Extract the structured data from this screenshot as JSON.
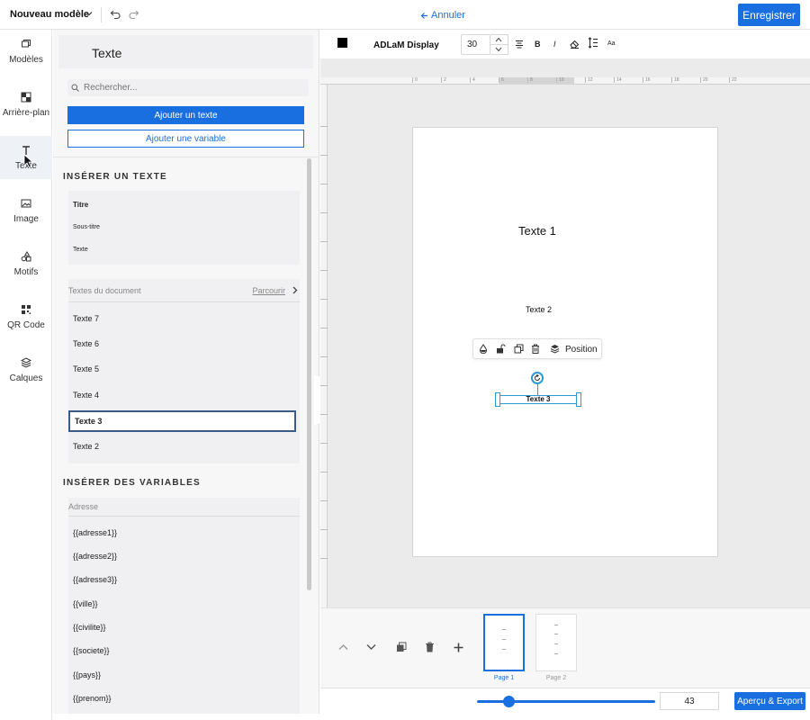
{
  "topbar": {
    "template_name": "Nouveau modèle",
    "cancel_label": "Annuler",
    "save_label": "Enregistrer"
  },
  "rail": {
    "items": [
      {
        "label": "Modèles",
        "icon": "templates-icon"
      },
      {
        "label": "Arrière-plan",
        "icon": "background-icon"
      },
      {
        "label": "Texte",
        "icon": "text-icon",
        "active": true
      },
      {
        "label": "Image",
        "icon": "image-icon"
      },
      {
        "label": "Motifs",
        "icon": "shapes-icon"
      },
      {
        "label": "QR Code",
        "icon": "qr-code-icon"
      },
      {
        "label": "Calques",
        "icon": "layers-icon"
      }
    ]
  },
  "panel": {
    "title": "Texte",
    "search_placeholder": "Rechercher...",
    "add_text_label": "Ajouter un texte",
    "add_variable_label": "Ajouter une variable",
    "insert_text_title": "INSÉRER UN TEXTE",
    "text_styles": [
      "Titre",
      "Sous-titre",
      "Texte"
    ],
    "doc_texts_label": "Textes du document",
    "browse_label": "Parcourir",
    "doc_texts": [
      "Texte 7",
      "Texte 6",
      "Texte 5",
      "Texte 4",
      "Texte 3",
      "Texte 2"
    ],
    "selected_doc_text": "Texte 3",
    "insert_variables_title": "INSÉRER DES VARIABLES",
    "address_group": "Adresse",
    "variables": [
      "{{adresse1}}",
      "{{adresse2}}",
      "{{adresse3}}",
      "{{ville}}",
      "{{civilite}}",
      "{{societe}}",
      "{{pays}}",
      "{{prenom}}"
    ]
  },
  "format_toolbar": {
    "color": "#000000",
    "font_name": "ADLaM Display",
    "font_size": "30",
    "bold_label": "B",
    "italic_label": "I",
    "case_label": "Aa"
  },
  "ruler": {
    "top_labels": [
      "0",
      "2",
      "4",
      "6",
      "8",
      "10",
      "12",
      "14",
      "16",
      "18",
      "20",
      "22"
    ]
  },
  "canvas": {
    "texts": [
      "Texte 1",
      "Texte 2",
      "Texte 3"
    ],
    "context_position_label": "Position"
  },
  "pages": {
    "items": [
      "Page 1",
      "Page 2"
    ],
    "active": "Page 1"
  },
  "zoom": {
    "value": "43",
    "level_fraction": 0.18
  },
  "export_label": "Aperçu & Export",
  "colors": {
    "accent": "#1a6fe0",
    "selection": "#2a9bd0"
  }
}
